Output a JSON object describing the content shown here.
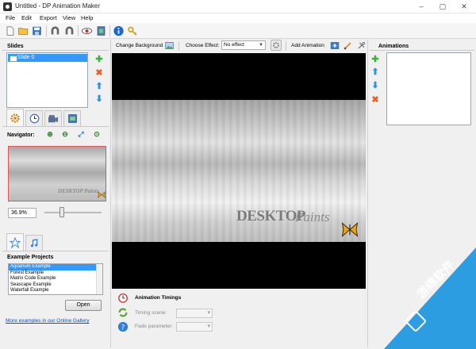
{
  "window": {
    "title": "Untitled - DP Animation Maker",
    "controls": [
      "–",
      "▢",
      "✕"
    ]
  },
  "menu": [
    "File",
    "Edit",
    "Export",
    "View",
    "Help"
  ],
  "toolbar_icons": [
    "new-file-icon",
    "open-folder-icon",
    "save-icon",
    "undo-icon",
    "redo-icon",
    "preview-eye-icon",
    "export-icon",
    "info-icon",
    "key-icon"
  ],
  "slides": {
    "header": "Slides",
    "items": [
      "Slide 0"
    ]
  },
  "left_tabs": [
    "settings-icon",
    "clock-icon",
    "camera-icon",
    "image-icon"
  ],
  "navigator": {
    "label": "Navigator:",
    "zoom_value": "36.9%",
    "zoom_level": 0.3,
    "preview_watermark": "DESKTOP Paints"
  },
  "lower_tabs": [
    "star-icon",
    "music-note-icon"
  ],
  "examples": {
    "header": "Example Projects",
    "items": [
      "Aquarium Example",
      "Forest Example",
      "Matrix Code Example",
      "Seascape Example",
      "Waterfall Example"
    ],
    "selected_index": 0,
    "open_button": "Open",
    "gallery_link": "More examples in our Online Gallery"
  },
  "editor_toolbar": {
    "change_background": "Change Background",
    "choose_effect_label": "Choose Effect:",
    "effect_value": "No effect",
    "add_animation": "Add Animation"
  },
  "canvas": {
    "watermark_main": "DESKTOP",
    "watermark_sub": "Paints"
  },
  "timings": {
    "header": "Animation Timings",
    "timing_scene_label": "Timing scene:",
    "fade_parameter_label": "Fade parameter:"
  },
  "animations": {
    "header": "Animations"
  },
  "promo": {
    "text": "游绵软件"
  },
  "colors": {
    "selection": "#3399ff",
    "link": "#0b4fd1",
    "promo": "#2d9de2",
    "add_green": "#3cb23c",
    "remove_orange": "#e8621c",
    "arrow_blue": "#2f8fe0"
  }
}
